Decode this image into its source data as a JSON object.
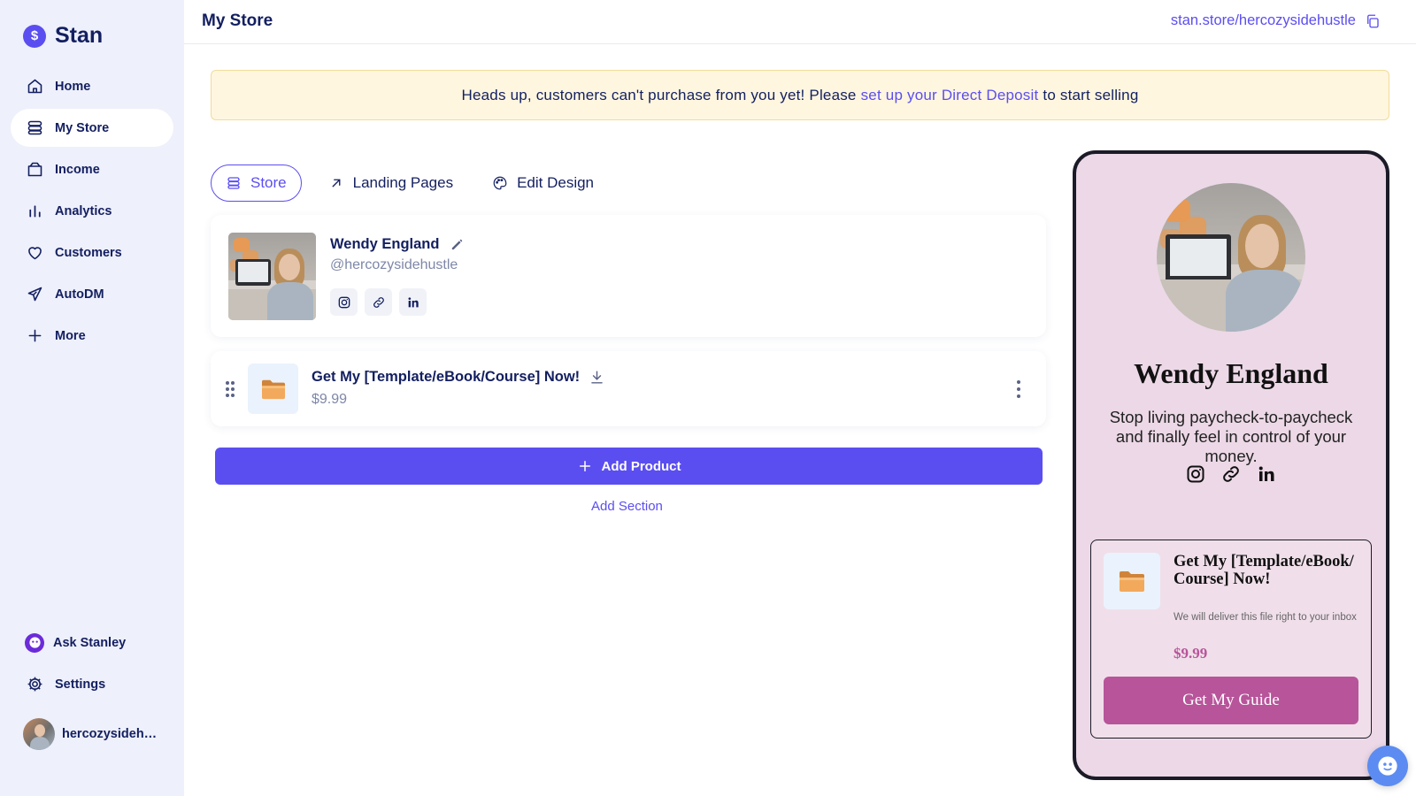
{
  "brand": {
    "name": "Stan",
    "logo_glyph": "$"
  },
  "sidebar": {
    "items": [
      {
        "label": "Home",
        "icon": "home-icon"
      },
      {
        "label": "My Store",
        "icon": "store-icon",
        "active": true
      },
      {
        "label": "Income",
        "icon": "wallet-icon"
      },
      {
        "label": "Analytics",
        "icon": "bar-chart-icon"
      },
      {
        "label": "Customers",
        "icon": "heart-icon"
      },
      {
        "label": "AutoDM",
        "icon": "send-icon"
      },
      {
        "label": "More",
        "icon": "plus-icon"
      }
    ],
    "bottom": [
      {
        "label": "Ask Stanley",
        "icon": "stanley-icon"
      },
      {
        "label": "Settings",
        "icon": "gear-icon"
      }
    ],
    "user": {
      "name": "hercozysidehustle"
    }
  },
  "header": {
    "title": "My Store",
    "store_url": "stan.store/hercozysidehustle"
  },
  "banner": {
    "text_before": "Heads up, customers can't purchase from you yet! Please",
    "link": "set up your Direct Deposit",
    "text_after": "to start selling"
  },
  "tabs": [
    {
      "label": "Store",
      "icon": "store-icon",
      "active": true
    },
    {
      "label": "Landing Pages",
      "icon": "arrow-up-right-icon"
    },
    {
      "label": "Edit Design",
      "icon": "palette-icon"
    }
  ],
  "profile": {
    "name": "Wendy England",
    "handle": "@hercozysidehustle",
    "socials": [
      "instagram-icon",
      "link-icon",
      "linkedin-icon"
    ]
  },
  "product": {
    "title": "Get My [Template/eBook/Course] Now!",
    "price": "$9.99"
  },
  "actions": {
    "add_product": "Add Product",
    "add_section": "Add Section"
  },
  "preview": {
    "name": "Wendy England",
    "bio": "Stop living paycheck-to-paycheck and finally feel in control of your money.",
    "card": {
      "title": "Get My [Template/eBook/Course] Now!",
      "description": "We will deliver this file right to your inbox",
      "price": "$9.99",
      "cta": "Get My Guide"
    }
  },
  "colors": {
    "accent": "#5b4ef0",
    "sidebar_bg": "#eef0fb",
    "banner_bg": "#fef6df",
    "preview_bg": "#ecd8e6",
    "preview_accent": "#b7549a"
  }
}
